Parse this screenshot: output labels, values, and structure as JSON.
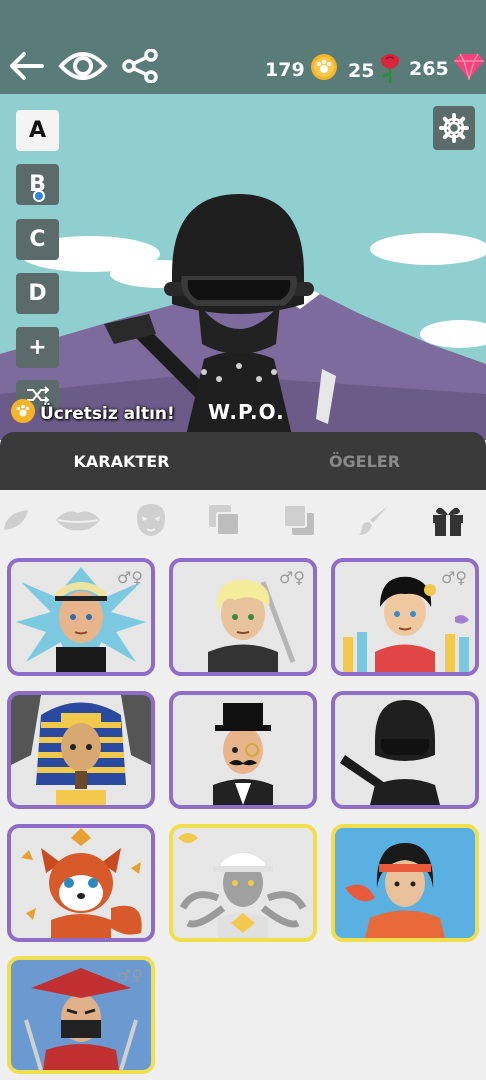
{
  "topbar": {
    "coins": "179",
    "roses": "25",
    "gems": "265",
    "colors": {
      "bar": "#5a7c79",
      "coin": "#f6b42a",
      "rose": "#d8263c",
      "gem": "#f0447a"
    }
  },
  "slots": [
    {
      "label": "A",
      "active": true
    },
    {
      "label": "B",
      "active": false
    },
    {
      "label": "C",
      "active": false
    },
    {
      "label": "D",
      "active": false
    },
    {
      "label": "+",
      "active": false
    }
  ],
  "scene": {
    "badge_text": "W.P.O.",
    "free_gold_label": "Ücretsiz altın!"
  },
  "tabs": [
    {
      "label": "KARAKTER",
      "active": true
    },
    {
      "label": "ÖGELER",
      "active": false
    }
  ],
  "categories": [
    "leaf-icon",
    "lips-icon",
    "mask-icon",
    "layers-icon",
    "layer-back-icon",
    "brush-icon",
    "gift-icon"
  ],
  "cards": [
    {
      "name": "ice-boy",
      "border": "purple",
      "gender": "♂♀"
    },
    {
      "name": "blonde-swordsman",
      "border": "purple",
      "gender": "♂♀"
    },
    {
      "name": "painter-boy",
      "border": "purple",
      "gender": "♂♀"
    },
    {
      "name": "pharaoh",
      "border": "purple",
      "gender": ""
    },
    {
      "name": "gentleman",
      "border": "purple",
      "gender": ""
    },
    {
      "name": "swat-soldier",
      "border": "purple",
      "gender": ""
    },
    {
      "name": "red-panda",
      "border": "purple",
      "gender": ""
    },
    {
      "name": "robot-arms",
      "border": "gold",
      "gender": ""
    },
    {
      "name": "kimono-girl",
      "border": "gold",
      "gender": ""
    },
    {
      "name": "ninja-samurai",
      "border": "gold",
      "gender": "♂♀"
    }
  ]
}
